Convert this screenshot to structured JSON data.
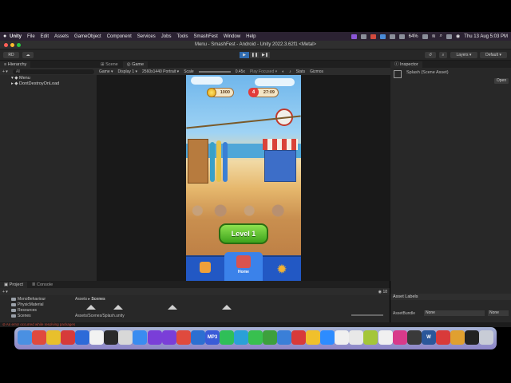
{
  "menubar": {
    "app_name": "Unity",
    "items": [
      "File",
      "Edit",
      "Assets",
      "GameObject",
      "Component",
      "Services",
      "Jobs",
      "Tools",
      "SmashFest",
      "Window",
      "Help"
    ],
    "battery": "64%",
    "clock": "Thu 13 Aug  5:03 PM"
  },
  "window": {
    "title": "Menu - SmashFest - Android - Unity 2022.3.62f1 <Metal>"
  },
  "toolbar": {
    "account_label": "RD",
    "layers_label": "Layers",
    "layout_label": "Default"
  },
  "hierarchy": {
    "tab_label": "Hierarchy",
    "search_placeholder": "All",
    "rows": [
      {
        "label": "Menu"
      },
      {
        "label": "DontDestroyOnLoad"
      }
    ]
  },
  "game_tabs": {
    "scene_label": "Scene",
    "game_label": "Game"
  },
  "game_bar": {
    "mode": "Game",
    "display": "Display 1",
    "resolution": "2560x1440 Portrait",
    "scale_label": "Scale",
    "scale_value": "0.45x",
    "play_focused": "Play Focused",
    "stats": "Stats",
    "gizmos": "Gizmos"
  },
  "game": {
    "coins": "1000",
    "lives": "4",
    "timer": "27:09",
    "level_button": "Level 1",
    "home_label": "Home"
  },
  "inspector": {
    "tab_label": "Inspector",
    "asset_title": "Splash (Scene Asset)",
    "open_button": "Open",
    "asset_labels": "Asset Labels",
    "asset_bundle_label": "AssetBundle",
    "asset_bundle_value": "None",
    "variant_value": "None"
  },
  "project": {
    "tab_project": "Project",
    "tab_console": "Console",
    "breadcrumb_root": "Assets",
    "breadcrumb_current": "Scenes",
    "folders": [
      "MonoBehaviour",
      "PhysicMaterial",
      "Resources",
      "Scenes"
    ],
    "path": "Assets/Scenes/Splash.unity",
    "count_badge": "18"
  },
  "status": {
    "message": "An error occurred while resolving packages"
  },
  "dock": {
    "apps": [
      {
        "name": "finder",
        "color": "#4a90e2",
        "glyph": ""
      },
      {
        "name": "launchpad",
        "color": "#e04a3e",
        "glyph": ""
      },
      {
        "name": "chrome",
        "color": "#e8c02c",
        "glyph": ""
      },
      {
        "name": "app-red",
        "color": "#d63a3a",
        "glyph": ""
      },
      {
        "name": "word-blue",
        "color": "#2d6ad8",
        "glyph": ""
      },
      {
        "name": "chrome-2",
        "color": "#f2f2f2",
        "glyph": ""
      },
      {
        "name": "terminal",
        "color": "#2a2a2a",
        "glyph": ""
      },
      {
        "name": "notes",
        "color": "#d8d8d8",
        "glyph": ""
      },
      {
        "name": "safari",
        "color": "#3a8cf0",
        "glyph": ""
      },
      {
        "name": "visual-studio",
        "color": "#7a3ed8",
        "glyph": ""
      },
      {
        "name": "visual-studio-code",
        "color": "#7a3ed8",
        "glyph": ""
      },
      {
        "name": "app-compass",
        "color": "#e04a3e",
        "glyph": ""
      },
      {
        "name": "app-blue",
        "color": "#2c6fd1",
        "glyph": ""
      },
      {
        "name": "mp3",
        "color": "#3a5bd8",
        "glyph": "MP3"
      },
      {
        "name": "whatsapp",
        "color": "#2fbf58",
        "glyph": ""
      },
      {
        "name": "app-cyan",
        "color": "#2aa0d8",
        "glyph": ""
      },
      {
        "name": "app-green",
        "color": "#38c04f",
        "glyph": ""
      },
      {
        "name": "app-c",
        "color": "#3da03d",
        "glyph": ""
      },
      {
        "name": "app-photo",
        "color": "#3a7fd8",
        "glyph": ""
      },
      {
        "name": "app-p",
        "color": "#d83a3a",
        "glyph": ""
      },
      {
        "name": "app-yellow",
        "color": "#f0c02c",
        "glyph": ""
      },
      {
        "name": "zoom",
        "color": "#2d8cff",
        "glyph": ""
      },
      {
        "name": "app-diamond",
        "color": "#f0f0f0",
        "glyph": ""
      },
      {
        "name": "app-gift",
        "color": "#e8e8e8",
        "glyph": ""
      },
      {
        "name": "android",
        "color": "#a4c639",
        "glyph": ""
      },
      {
        "name": "app-doc",
        "color": "#f0f0f0",
        "glyph": ""
      },
      {
        "name": "app-stripes",
        "color": "#d83a8a",
        "glyph": ""
      },
      {
        "name": "unity-hub",
        "color": "#3a3a3a",
        "glyph": ""
      },
      {
        "name": "word",
        "color": "#2b579a",
        "glyph": "W"
      },
      {
        "name": "app-circle",
        "color": "#d83a3a",
        "glyph": ""
      },
      {
        "name": "app-orange",
        "color": "#e0a030",
        "glyph": ""
      },
      {
        "name": "unity",
        "color": "#222222",
        "glyph": ""
      },
      {
        "name": "trash",
        "color": "#c8ccd6",
        "glyph": ""
      }
    ]
  }
}
